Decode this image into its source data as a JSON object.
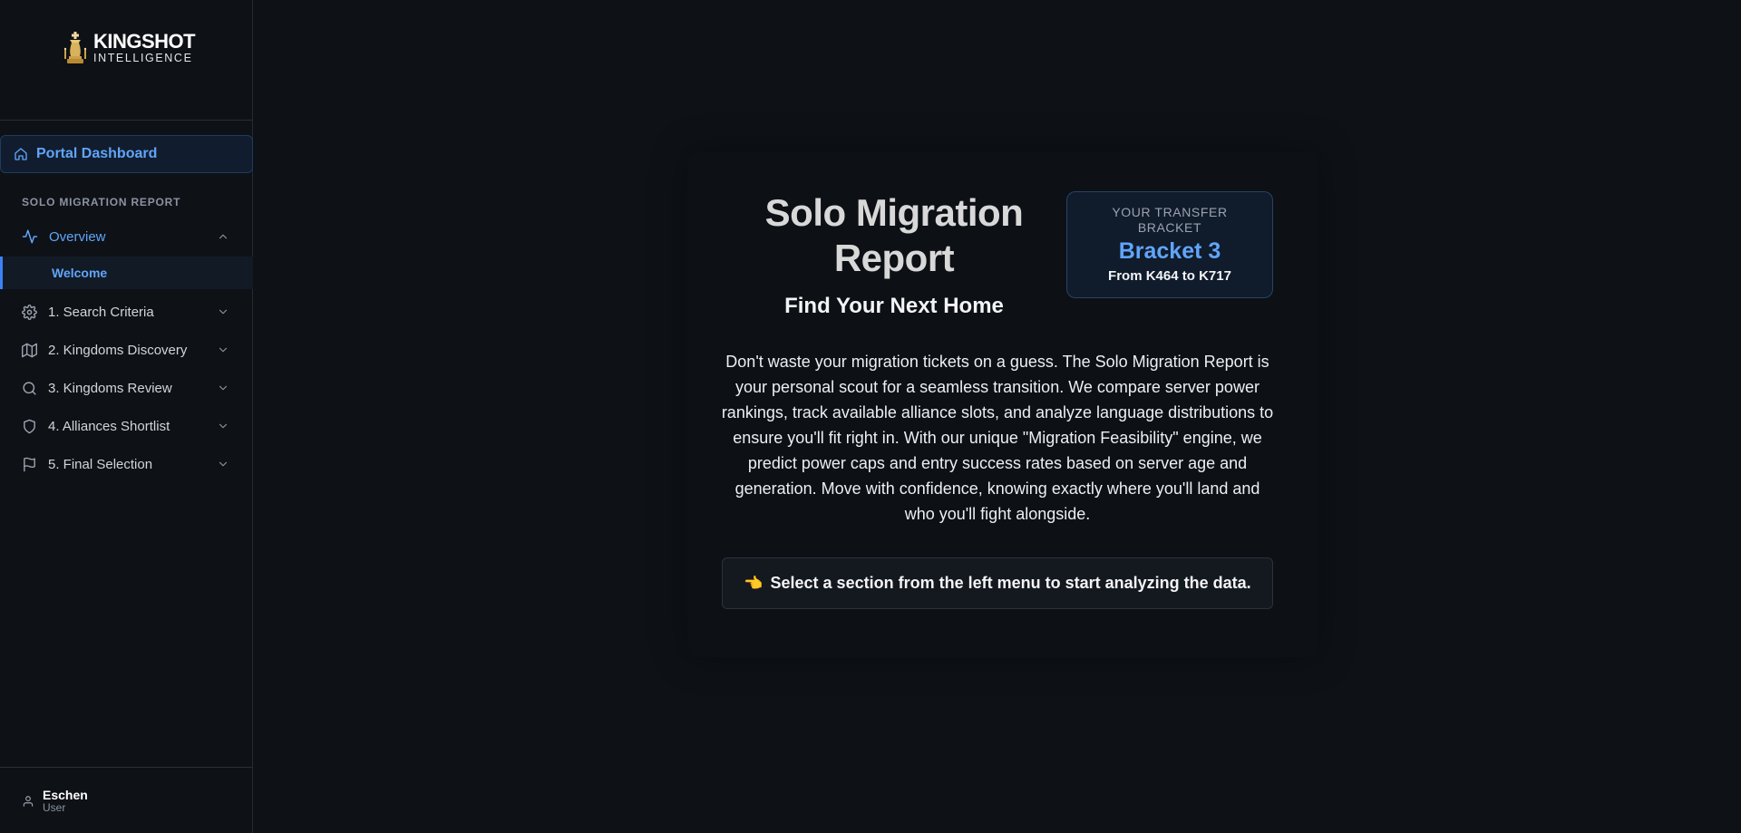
{
  "brand": {
    "name": "KINGSHOT",
    "subtitle": "INTELLIGENCE"
  },
  "sidebar": {
    "portal_label": "Portal Dashboard",
    "section_title": "SOLO MIGRATION REPORT",
    "items": [
      {
        "label": "Overview",
        "icon": "activity-icon",
        "expanded": true,
        "active": true
      },
      {
        "label": "1. Search Criteria",
        "icon": "gear-icon",
        "expanded": false
      },
      {
        "label": "2. Kingdoms Discovery",
        "icon": "map-icon",
        "expanded": false
      },
      {
        "label": "3. Kingdoms Review",
        "icon": "search-icon",
        "expanded": false
      },
      {
        "label": "4. Alliances Shortlist",
        "icon": "shield-icon",
        "expanded": false
      },
      {
        "label": "5. Final Selection",
        "icon": "flag-icon",
        "expanded": false
      }
    ],
    "sub_item": "Welcome"
  },
  "user": {
    "name": "Eschen",
    "role": "User"
  },
  "main": {
    "title": "Solo Migration Report",
    "subtitle": "Find Your Next Home",
    "bracket": {
      "caption": "YOUR TRANSFER BRACKET",
      "value": "Bracket 3",
      "range": "From K464 to K717"
    },
    "description": "Don't waste your migration tickets on a guess. The Solo Migration Report is your personal scout for a seamless transition. We compare server power rankings, track available alliance slots, and analyze language distributions to ensure you'll fit right in. With our unique \"Migration Feasibility\" engine, we predict power caps and entry success rates based on server age and generation. Move with confidence, knowing exactly where you'll land and who you'll fight alongside.",
    "cta_emoji": "👈",
    "cta": "Select a section from the left menu to start analyzing the data."
  },
  "colors": {
    "accent": "#60a5fa",
    "background": "#0e1116",
    "sidebar_border": "#262b33"
  }
}
